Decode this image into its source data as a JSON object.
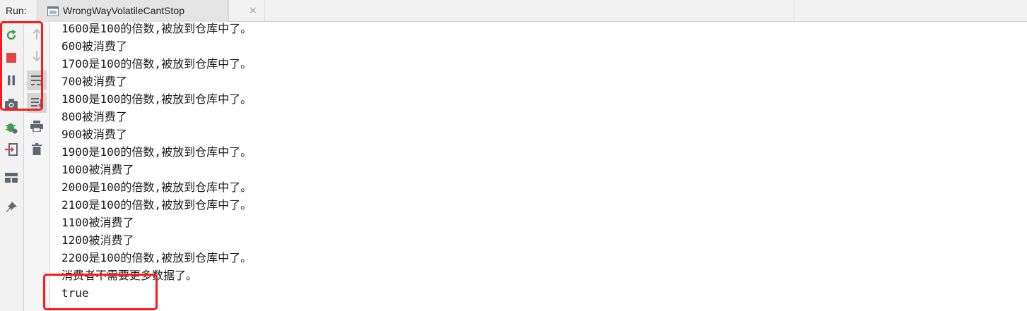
{
  "run_bar": {
    "label": "Run:",
    "tab_title": "WrongWayVolatileCantStop",
    "tab_close": "×"
  },
  "toolbar_left": [
    "rerun-icon",
    "stop-icon",
    "pause-icon",
    "camera-icon",
    "debug-settings-icon",
    "exit-icon",
    "layout-icon",
    "pin-icon"
  ],
  "toolbar_right": [
    "up-arrow-icon",
    "down-arrow-icon",
    "soft-wrap-icon",
    "scroll-to-end-icon",
    "print-icon",
    "trash-icon"
  ],
  "colors": {
    "annotation": "#ff1a1a",
    "rerun": "#3aa04a",
    "stop": "#e0454a"
  },
  "console": {
    "lines": [
      "1600是100的倍数,被放到仓库中了。",
      "600被消费了",
      "1700是100的倍数,被放到仓库中了。",
      "700被消费了",
      "1800是100的倍数,被放到仓库中了。",
      "800被消费了",
      "900被消费了",
      "1900是100的倍数,被放到仓库中了。",
      "1000被消费了",
      "2000是100的倍数,被放到仓库中了。",
      "2100是100的倍数,被放到仓库中了。",
      "1100被消费了",
      "1200被消费了",
      "2200是100的倍数,被放到仓库中了。",
      "消费者不需要更多数据了。",
      "true"
    ]
  }
}
